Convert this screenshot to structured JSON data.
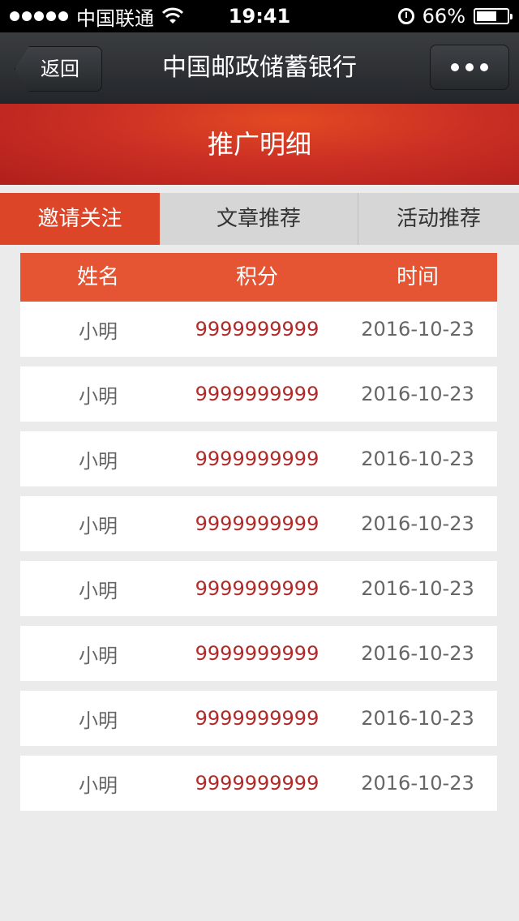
{
  "status_bar": {
    "carrier": "中国联通",
    "time": "19:41",
    "battery": "66%",
    "battery_level": 0.66
  },
  "nav": {
    "back_label": "返回",
    "title": "中国邮政储蓄银行",
    "more_icon": "more-dots-icon"
  },
  "banner": {
    "title": "推广明细"
  },
  "tabs": [
    {
      "label": "邀请关注",
      "active": true
    },
    {
      "label": "文章推荐",
      "active": false
    },
    {
      "label": "活动推荐",
      "active": false
    }
  ],
  "table": {
    "headers": [
      "姓名",
      "积分",
      "时间"
    ],
    "rows": [
      [
        "小明",
        "9999999999",
        "2016-10-23"
      ],
      [
        "小明",
        "9999999999",
        "2016-10-23"
      ],
      [
        "小明",
        "9999999999",
        "2016-10-23"
      ],
      [
        "小明",
        "9999999999",
        "2016-10-23"
      ],
      [
        "小明",
        "9999999999",
        "2016-10-23"
      ],
      [
        "小明",
        "9999999999",
        "2016-10-23"
      ],
      [
        "小明",
        "9999999999",
        "2016-10-23"
      ],
      [
        "小明",
        "9999999999",
        "2016-10-23"
      ]
    ]
  },
  "colors": {
    "accent": "#dc4527",
    "header": "#e65533",
    "points": "#b02a2a"
  }
}
